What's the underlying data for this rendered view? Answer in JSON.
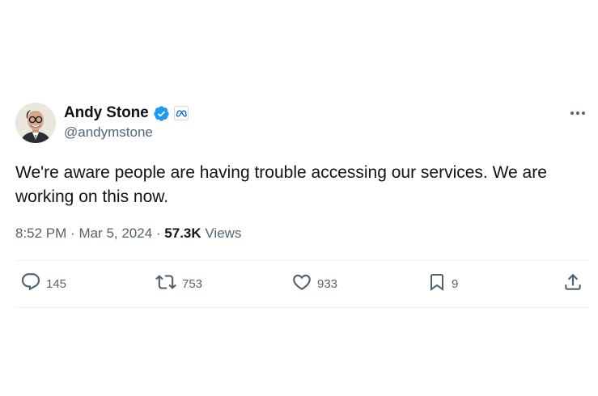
{
  "author": {
    "display_name": "Andy Stone",
    "handle": "@andymstone",
    "verified_icon": "verified-badge-icon",
    "affiliation_icon": "meta-logo-icon"
  },
  "tweet": {
    "text": "We're aware people are having trouble accessing our services. We are working on this now.",
    "time": "8:52 PM",
    "separator": "·",
    "date": "Mar 5, 2024",
    "views_count": "57.3K",
    "views_label": "Views"
  },
  "actions": {
    "replies": "145",
    "reposts": "753",
    "likes": "933",
    "bookmarks": "9"
  },
  "colors": {
    "text_primary": "#0f1419",
    "text_secondary": "#536471",
    "verified_blue": "#1d9bf0",
    "meta_blue": "#0668e1",
    "divider": "#eff3f4"
  }
}
